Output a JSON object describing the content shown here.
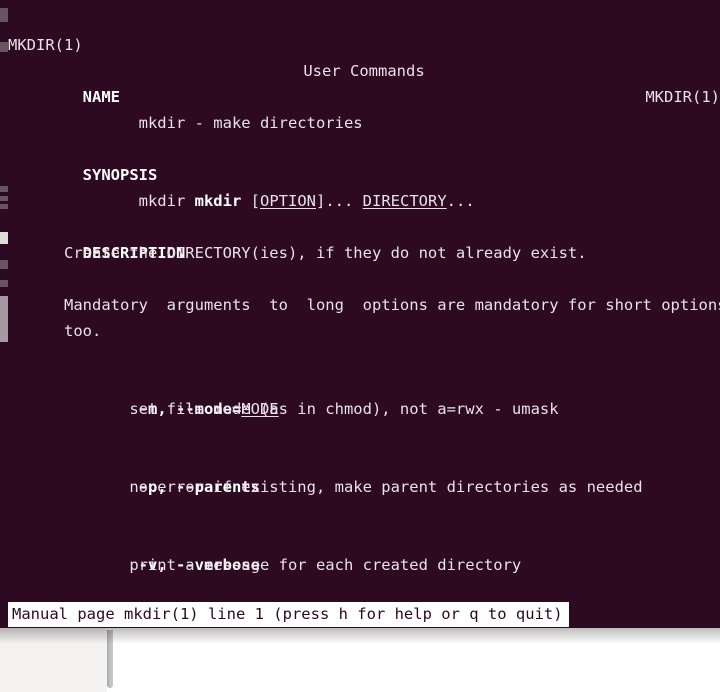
{
  "theme": {
    "terminal_bg": "#2d0922",
    "terminal_fg": "#e8e2e6",
    "status_bg": "#ffffff",
    "status_fg": "#2d0922",
    "background_window_bg": "#ffffff",
    "background_sidebar_bg": "#f4f3f2",
    "divider": "#bdbdbd"
  },
  "man_page": {
    "header": {
      "left": "MKDIR(1)",
      "center": "User Commands",
      "right": "MKDIR(1)"
    },
    "sections": [
      {
        "heading": "NAME",
        "body": [
          "mkdir - make directories"
        ]
      },
      {
        "heading": "SYNOPSIS",
        "body": [
          "mkdir [OPTION]... DIRECTORY..."
        ]
      },
      {
        "heading": "DESCRIPTION",
        "body": [
          "Create the DIRECTORY(ies), if they do not already exist.",
          "Mandatory  arguments  to  long  options are mandatory for short options",
          "too."
        ]
      }
    ],
    "options": [
      {
        "short": "-m",
        "long": "--mode=",
        "arg": "MODE",
        "description": "set file mode (as in chmod), not a=rwx - umask"
      },
      {
        "short": "-p",
        "long": "--parents",
        "arg": "",
        "description": "no error if existing, make parent directories as needed"
      },
      {
        "short": "-v",
        "long": "--verbose",
        "arg": "",
        "description": "print a message for each created directory"
      }
    ],
    "lines": {
      "name_heading": "NAME",
      "name_body": "      mkdir - make directories",
      "synopsis_heading": "SYNOPSIS",
      "synopsis_mkdir": "      mkdir ",
      "synopsis_bracket_open": "[",
      "synopsis_option": "OPTION",
      "synopsis_bracket_close": "]... ",
      "synopsis_directory": "DIRECTORY",
      "synopsis_tail": "...",
      "description_heading": "DESCRIPTION",
      "description_line1": "      Create the DIRECTORY(ies), if they do not already exist.",
      "description_line2": "      Mandatory  arguments  to  long  options are mandatory for short options",
      "description_line3": "      too.",
      "opt_m_indent": "      ",
      "opt_m_flags": "-m, --mode=",
      "opt_m_arg": "MODE",
      "opt_m_desc": "             set file mode (as in chmod), not a=rwx - umask",
      "opt_p_indent": "      ",
      "opt_p_flags": "-p, --parents",
      "opt_p_desc": "             no error if existing, make parent directories as needed",
      "opt_v_indent": "      ",
      "opt_v_flags": "-v, --verbose",
      "opt_v_desc": "             print a message for each created directory"
    }
  },
  "pager": {
    "status_text": "Manual page mkdir(1) line 1 (press h for help or q to quit)"
  }
}
